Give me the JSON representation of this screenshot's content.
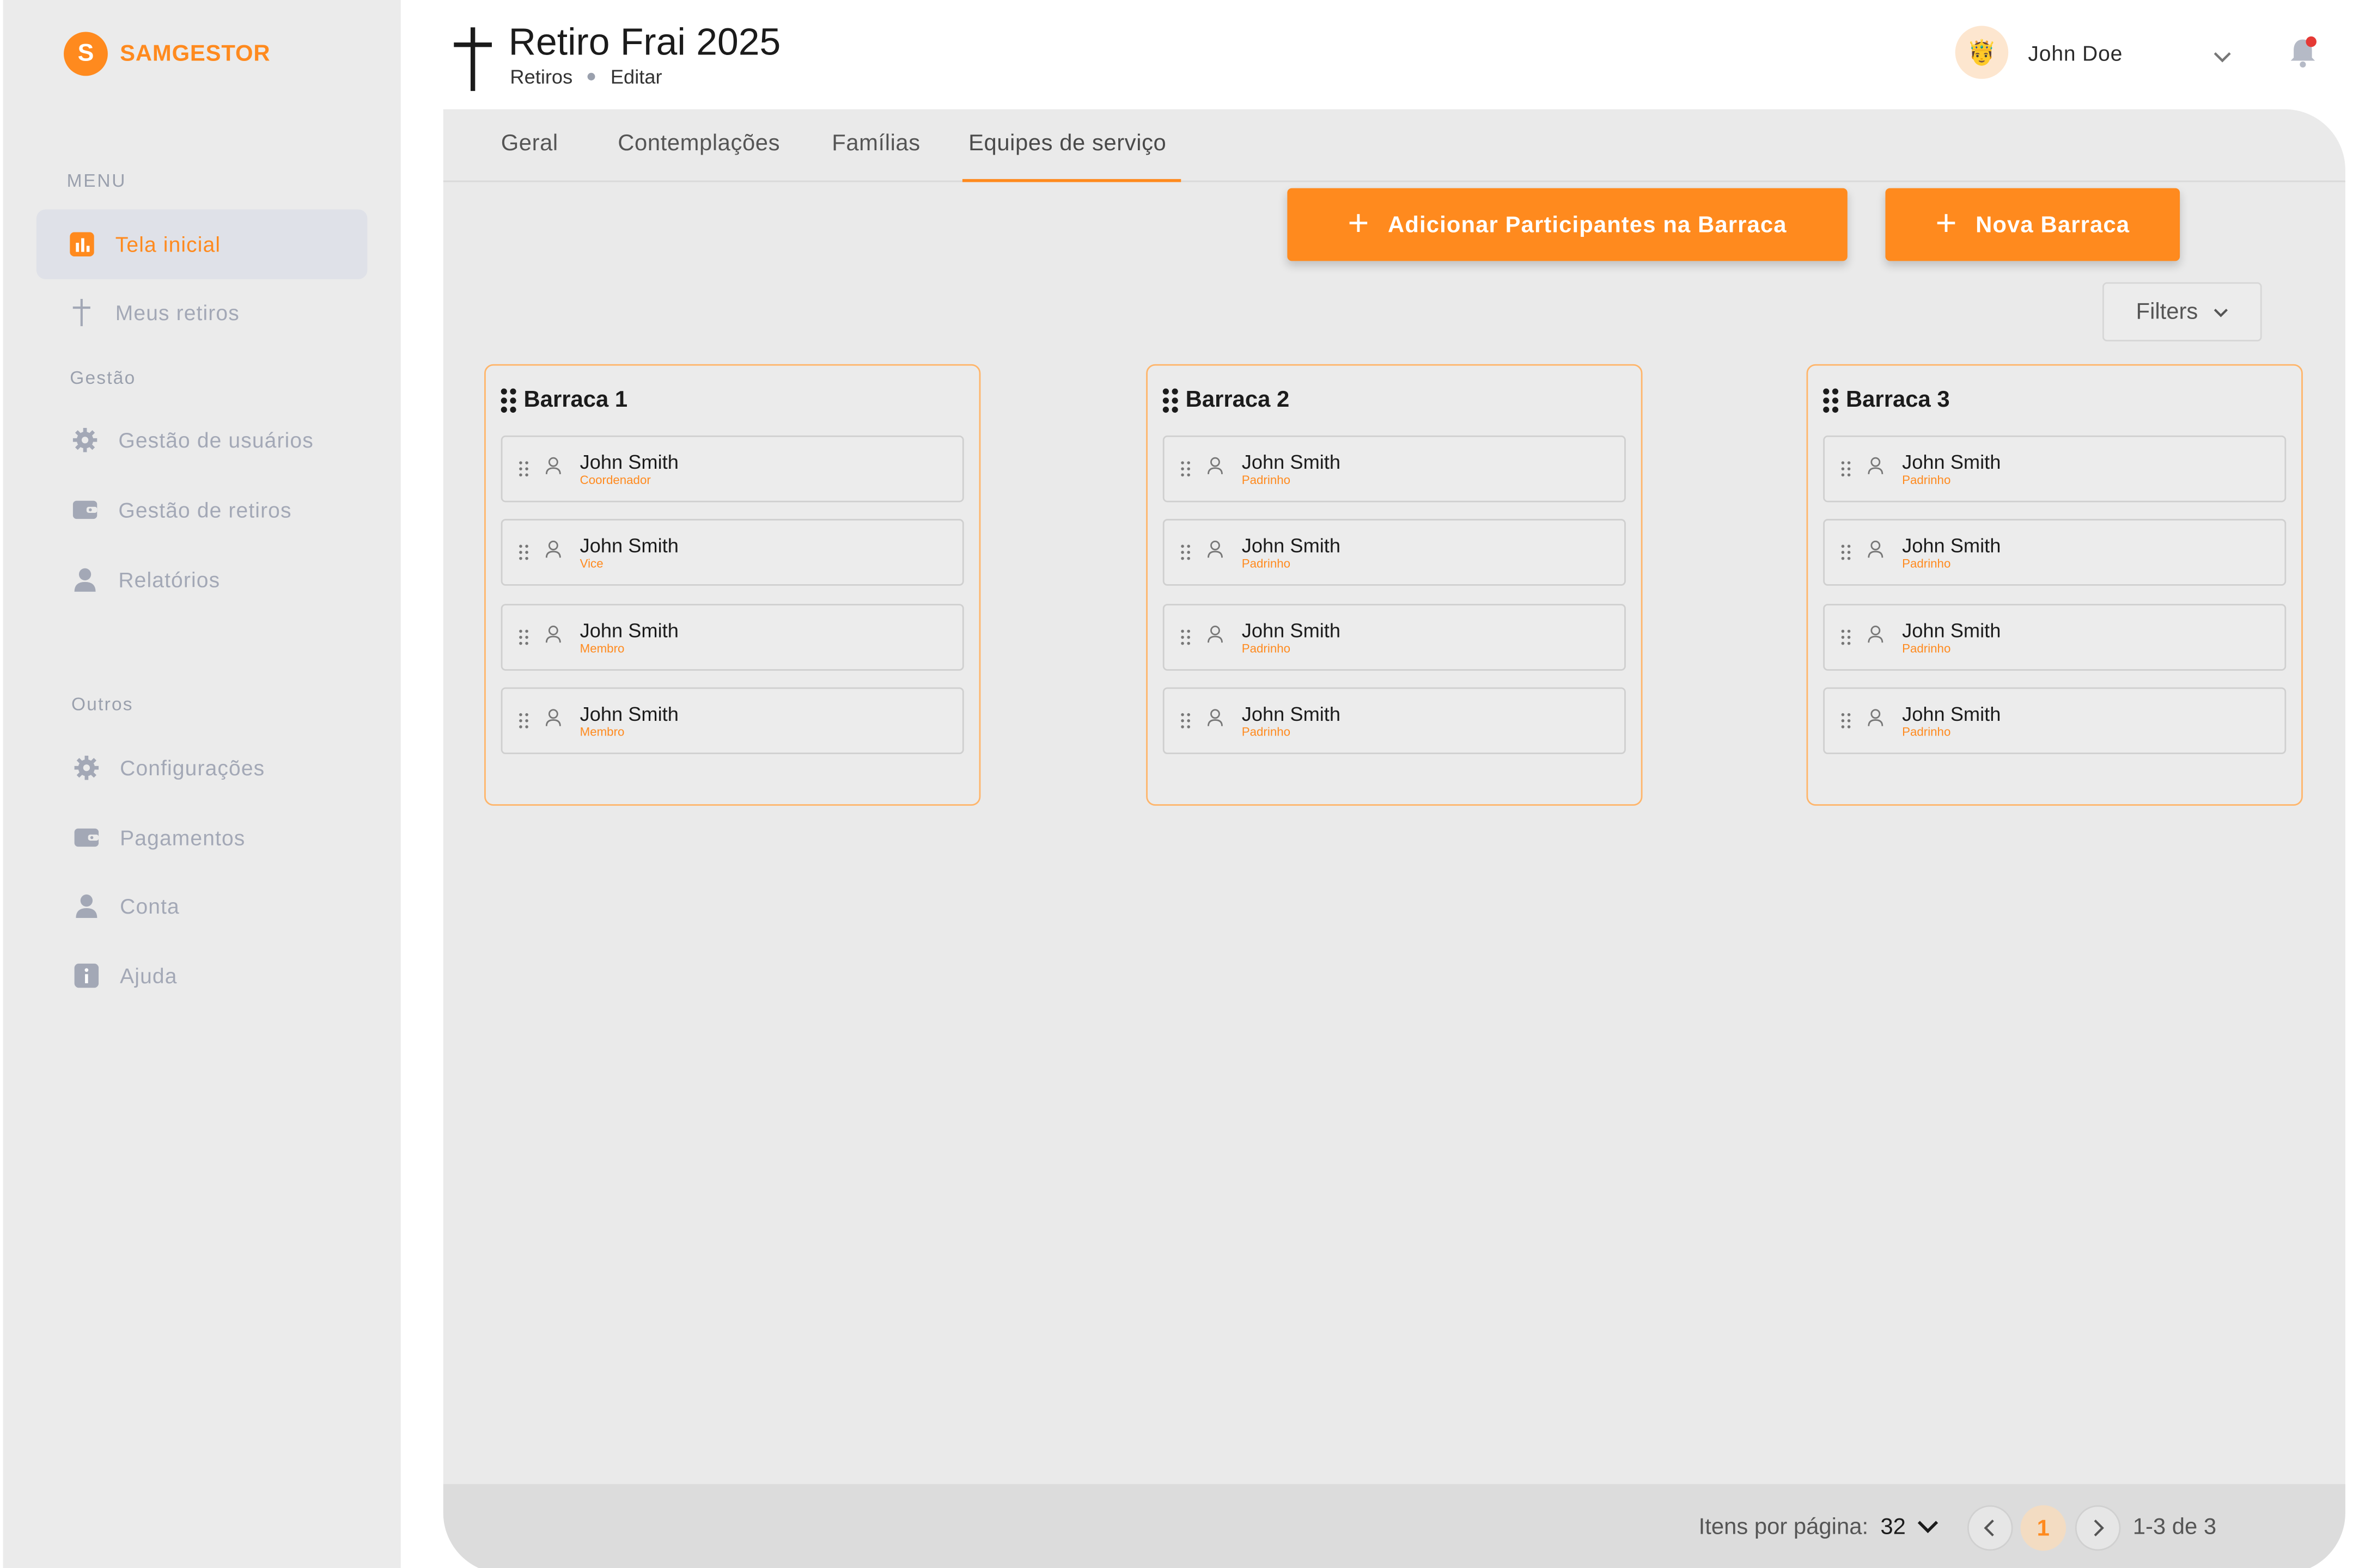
{
  "brand": {
    "logo_letter": "S",
    "name": "SAMGESTOR",
    "accent": "#ff8a1e"
  },
  "sidebar": {
    "menu_label": "MENU",
    "menu_items": [
      {
        "label": "Tela inicial",
        "icon": "bar-chart-icon",
        "active": true
      },
      {
        "label": "Meus retiros",
        "icon": "cross-icon"
      }
    ],
    "gestao_label": "Gestão",
    "gestao_items": [
      {
        "label": "Gestão de usuários",
        "icon": "gear-icon"
      },
      {
        "label": "Gestão de retiros",
        "icon": "wallet-icon"
      },
      {
        "label": "Relatórios",
        "icon": "user-icon"
      }
    ],
    "outros_label": "Outros",
    "outros_items": [
      {
        "label": "Configurações",
        "icon": "gear-icon"
      },
      {
        "label": "Pagamentos",
        "icon": "wallet-icon"
      },
      {
        "label": "Conta",
        "icon": "user-icon"
      },
      {
        "label": "Ajuda",
        "icon": "info-icon"
      }
    ]
  },
  "header": {
    "title": "Retiro Frai 2025",
    "breadcrumb": [
      "Retiros",
      "Editar"
    ],
    "user_name": "John Doe",
    "avatar": "🤴"
  },
  "tabs": [
    "Geral",
    "Contemplações",
    "Famílias",
    "Equipes de serviço"
  ],
  "active_tab": "Equipes de serviço",
  "actions": {
    "add_participants": "Adicionar Participantes na Barraca",
    "new_tent": "Nova Barraca",
    "filters": "Filters"
  },
  "tents": [
    {
      "name": "Barraca 1",
      "members": [
        {
          "name": "John Smith",
          "role": "Coordenador"
        },
        {
          "name": "John Smith",
          "role": "Vice"
        },
        {
          "name": "John Smith",
          "role": "Membro"
        },
        {
          "name": "John Smith",
          "role": "Membro"
        }
      ]
    },
    {
      "name": "Barraca 2",
      "members": [
        {
          "name": "John Smith",
          "role": "Padrinho"
        },
        {
          "name": "John Smith",
          "role": "Padrinho"
        },
        {
          "name": "John Smith",
          "role": "Padrinho"
        },
        {
          "name": "John Smith",
          "role": "Padrinho"
        }
      ]
    },
    {
      "name": "Barraca 3",
      "members": [
        {
          "name": "John Smith",
          "role": "Padrinho"
        },
        {
          "name": "John Smith",
          "role": "Padrinho"
        },
        {
          "name": "John Smith",
          "role": "Padrinho"
        },
        {
          "name": "John Smith",
          "role": "Padrinho"
        }
      ]
    }
  ],
  "pagination": {
    "per_page_label": "Itens por página:",
    "per_page_value": "32",
    "current_page": "1",
    "range": "1-3 de 3"
  }
}
